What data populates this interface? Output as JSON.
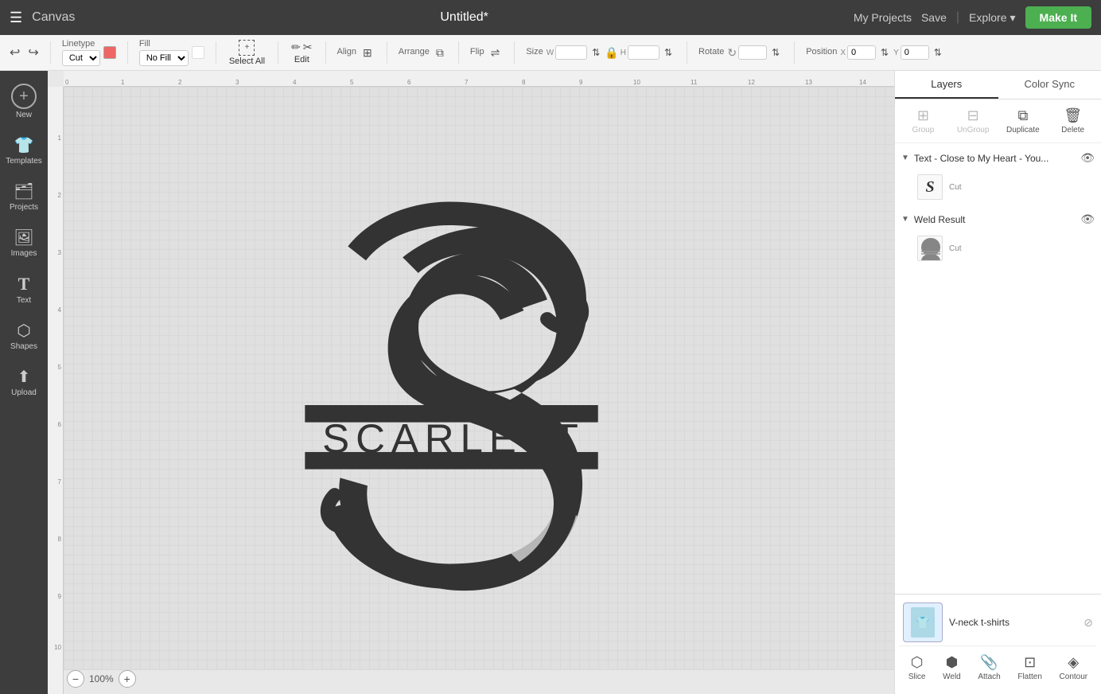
{
  "topbar": {
    "menu_icon": "☰",
    "app_title": "Canvas",
    "doc_title": "Untitled*",
    "my_projects_label": "My Projects",
    "save_label": "Save",
    "explore_label": "Explore",
    "make_label": "Make It"
  },
  "toolbar": {
    "undo_icon": "↩",
    "redo_icon": "↪",
    "linetype_label": "Linetype",
    "linetype_value": "Cut",
    "fill_label": "Fill",
    "fill_value": "No Fill",
    "select_all_label": "Select All",
    "edit_label": "Edit",
    "align_label": "Align",
    "arrange_label": "Arrange",
    "flip_label": "Flip",
    "size_label": "Size",
    "w_label": "W",
    "h_label": "H",
    "lock_icon": "🔒",
    "rotate_label": "Rotate",
    "position_label": "Position",
    "x_label": "X",
    "y_label": "Y",
    "x_value": "0",
    "y_value": "0",
    "w_value": "",
    "h_value": "",
    "rotate_value": ""
  },
  "sidebar": {
    "new_label": "New",
    "templates_label": "Templates",
    "projects_label": "Projects",
    "images_label": "Images",
    "text_label": "Text",
    "shapes_label": "Shapes",
    "upload_label": "Upload"
  },
  "right_panel": {
    "layers_tab": "Layers",
    "color_sync_tab": "Color Sync",
    "group_label": "Group",
    "ungroup_label": "UnGroup",
    "duplicate_label": "Duplicate",
    "delete_label": "Delete",
    "layer1_name": "Text - Close to My Heart - You...",
    "layer1_thumb": "S",
    "layer1_type": "Cut",
    "layer2_name": "Weld Result",
    "layer2_type": "Cut",
    "mat_label": "V-neck t-shirts",
    "slice_label": "Slice",
    "weld_label": "Weld",
    "attach_label": "Attach",
    "flatten_label": "Flatten",
    "contour_label": "Contour"
  },
  "zoom": {
    "level": "100%"
  },
  "canvas": {
    "ruler_numbers": [
      "0",
      "1",
      "2",
      "3",
      "4",
      "5",
      "6",
      "7",
      "8",
      "9",
      "10",
      "11",
      "12",
      "13",
      "14"
    ],
    "ruler_numbers_v": [
      "1",
      "2",
      "3",
      "4",
      "5",
      "6",
      "7",
      "8",
      "9",
      "10"
    ]
  }
}
